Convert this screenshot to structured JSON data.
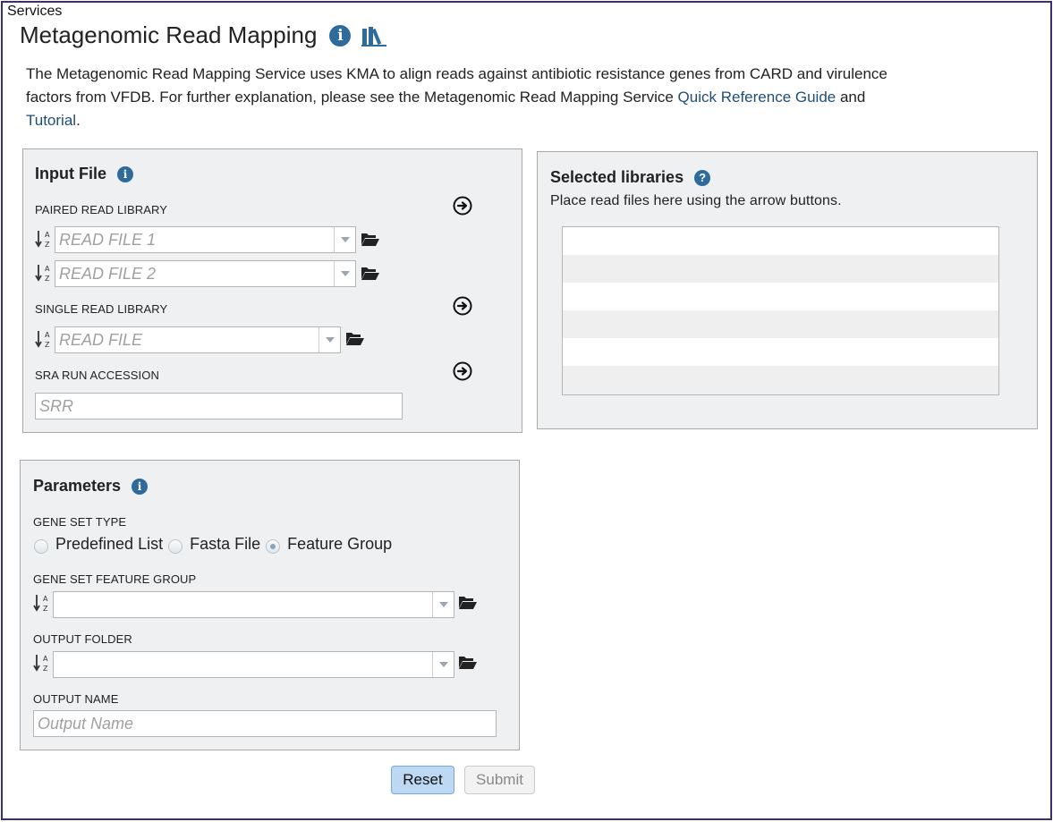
{
  "breadcrumb": "Services",
  "page": {
    "title": "Metagenomic Read Mapping",
    "description_part1": "The Metagenomic Read Mapping Service uses KMA to align reads against antibiotic resistance genes from CARD and virulence factors from VFDB. For further explanation, please see the Metagenomic Read Mapping Service ",
    "link_quick_ref": "Quick Reference Guide",
    "description_and": " and ",
    "link_tutorial": "Tutorial",
    "description_end": "."
  },
  "input_file": {
    "title": "Input File",
    "paired_label": "PAIRED READ LIBRARY",
    "read_file_1_placeholder": "READ FILE 1",
    "read_file_2_placeholder": "READ FILE 2",
    "single_label": "SINGLE READ LIBRARY",
    "read_file_placeholder": "READ FILE",
    "sra_label": "SRA RUN ACCESSION",
    "sra_placeholder": "SRR"
  },
  "selected_libraries": {
    "title": "Selected libraries",
    "hint": "Place read files here using the arrow buttons.",
    "rows": 6
  },
  "parameters": {
    "title": "Parameters",
    "gene_set_type_label": "GENE SET TYPE",
    "options": [
      "Predefined List",
      "Fasta File",
      "Feature Group"
    ],
    "selected_option": "Feature Group",
    "feature_group_label": "GENE SET FEATURE GROUP",
    "feature_group_value": "",
    "output_folder_label": "OUTPUT FOLDER",
    "output_folder_value": "",
    "output_name_label": "OUTPUT NAME",
    "output_name_placeholder": "Output Name"
  },
  "actions": {
    "reset": "Reset",
    "submit": "Submit"
  },
  "colors": {
    "accent": "#2f6b9a",
    "link": "#1f4e79",
    "frame": "#3b2d7a",
    "panel_bg": "#eff0f2"
  }
}
